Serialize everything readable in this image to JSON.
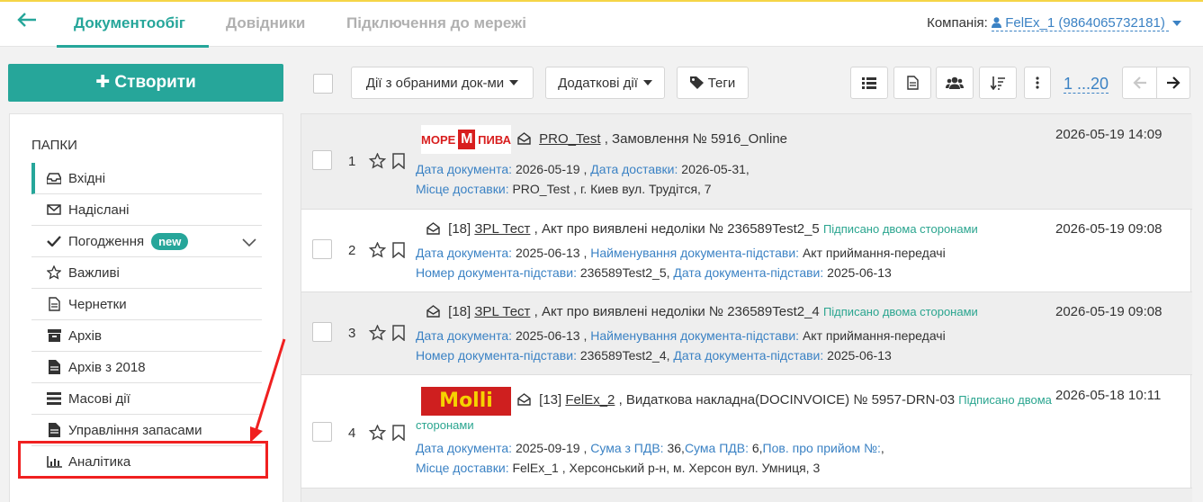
{
  "nav": {
    "back_icon": "arrow-left-icon",
    "tabs": [
      {
        "label": "Документообіг",
        "active": true
      },
      {
        "label": "Довідники",
        "active": false
      },
      {
        "label": "Підключення до мережі",
        "active": false
      }
    ],
    "company_label": "Компанія:",
    "company_value": "FelEx_1 (9864065732181)"
  },
  "sidebar": {
    "create_label": "Створити",
    "folders_title": "ПАПКИ",
    "items": [
      {
        "label": "Вхідні",
        "icon": "inbox-icon",
        "active": true
      },
      {
        "label": "Надіслані",
        "icon": "envelope-icon"
      },
      {
        "label": "Погодження",
        "icon": "check-icon",
        "badge": "new"
      },
      {
        "label": "Важливі",
        "icon": "star-icon"
      },
      {
        "label": "Чернетки",
        "icon": "file-icon"
      },
      {
        "label": "Архів",
        "icon": "archive-icon"
      },
      {
        "label": "Архів з 2018",
        "icon": "file-solid-icon"
      },
      {
        "label": "Масові дії",
        "icon": "layers-icon"
      },
      {
        "label": "Управління запасами",
        "icon": "file-solid-icon"
      },
      {
        "label": "Аналітика",
        "icon": "bar-chart-icon"
      }
    ]
  },
  "toolbar": {
    "bulk_actions": "Дії з обраними док-ми",
    "extra_actions": "Додаткові дії",
    "tags": "Теги",
    "pager": "1 ...20"
  },
  "docs": [
    {
      "num": "1",
      "logo": "МОРЕ М ПИВА",
      "counterparty": "PRO_Test",
      "title": "Замовлення № 5916_Online",
      "signed": "",
      "date": "2026-05-19 14:09",
      "line1": [
        {
          "k": "Дата документа:",
          "v": "2026-05-19"
        },
        {
          "k": "Дата доставки:",
          "v": "2026-05-31,"
        }
      ],
      "line2": [
        {
          "k": "Місце доставки:",
          "v": "PRO_Test , г. Киев вул. Трудітся, 7"
        }
      ]
    },
    {
      "num": "2",
      "prefix": "[18]",
      "counterparty": "ЗPL Тест",
      "title": "Акт про виявлені недоліки № 236589Test2_5",
      "signed": "Підписано двома сторонами",
      "date": "2026-05-19 09:08",
      "line1": [
        {
          "k": "Дата документа:",
          "v": "2025-06-13"
        },
        {
          "k": "Найменування документа-підстави:",
          "v": "Акт приймання-передачі"
        }
      ],
      "line2": [
        {
          "k": "Номер документа-підстави:",
          "v": "236589Test2_5,"
        },
        {
          "k": "Дата документа-підстави:",
          "v": "2025-06-13"
        }
      ]
    },
    {
      "num": "3",
      "prefix": "[18]",
      "counterparty": "ЗPL Тест",
      "title": "Акт про виявлені недоліки № 236589Test2_4",
      "signed": "Підписано двома сторонами",
      "date": "2026-05-19 09:08",
      "line1": [
        {
          "k": "Дата документа:",
          "v": "2025-06-13"
        },
        {
          "k": "Найменування документа-підстави:",
          "v": "Акт приймання-передачі"
        }
      ],
      "line2": [
        {
          "k": "Номер документа-підстави:",
          "v": "236589Test2_4,"
        },
        {
          "k": "Дата документа-підстави:",
          "v": "2025-06-13"
        }
      ]
    },
    {
      "num": "4",
      "logo": "Molli",
      "prefix": "[13]",
      "counterparty": "FelEx_2",
      "title": "Видаткова накладна(DOCINVOICE) № 5957-DRN-03",
      "signed": "Підписано двома",
      "signed2": "сторонами",
      "date": "2026-05-18 10:11",
      "line1": [
        {
          "k": "Дата документа:",
          "v": "2025-09-19"
        },
        {
          "k": "Сума з ПДВ:",
          "v": "36,"
        },
        {
          "k": "Сума ПДВ:",
          "v": "6,"
        },
        {
          "k": "Пов. про прийом №:",
          "v": ","
        }
      ],
      "line2": [
        {
          "k": "Місце доставки:",
          "v": "FelEx_1 , Херсонський р-н, м. Херсон вул. Умниця, 3"
        }
      ]
    }
  ],
  "colors": {
    "accent": "#26a69a",
    "link": "#3b82c4",
    "highlight": "#f02020"
  }
}
